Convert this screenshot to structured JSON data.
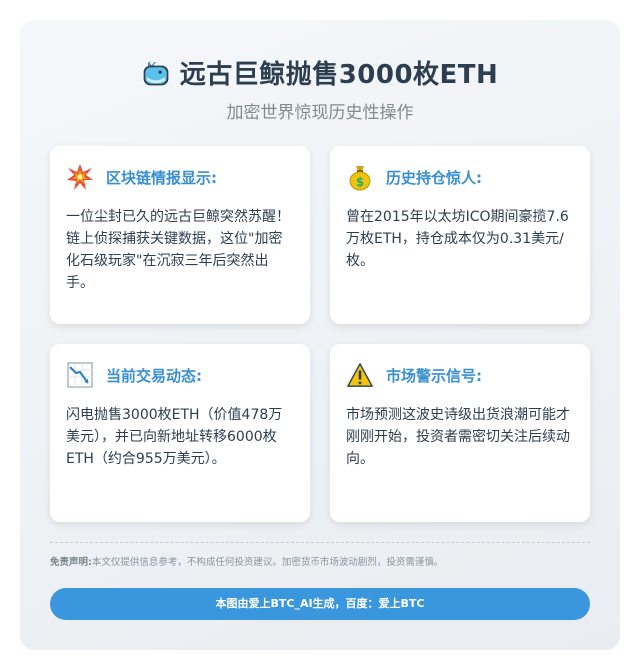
{
  "header": {
    "title": "远古巨鲸抛售3000枚ETH",
    "subtitle": "加密世界惊现历史性操作",
    "title_icon": "whale-icon"
  },
  "cards": [
    {
      "icon": "collision-icon",
      "title": "区块链情报显示:",
      "body": "一位尘封已久的远古巨鲸突然苏醒！链上侦探捕获关键数据，这位\"加密化石级玩家\"在沉寂三年后突然出手。"
    },
    {
      "icon": "money-bag-icon",
      "title": "历史持仓惊人:",
      "body": "曾在2015年以太坊ICO期间豪揽7.6万枚ETH，持仓成本仅为0.31美元/枚。"
    },
    {
      "icon": "chart-decreasing-icon",
      "title": "当前交易动态:",
      "body": "闪电抛售3000枚ETH（价值478万美元），并已向新地址转移6000枚ETH（约合955万美元）。"
    },
    {
      "icon": "warning-icon",
      "title": "市场警示信号:",
      "body": "市场预测这波史诗级出货浪潮可能才刚刚开始，投资者需密切关注后续动向。"
    }
  ],
  "footer": {
    "disclaimer_label": "免责声明:",
    "disclaimer_text": "本文仅提供信息参考，不构成任何投资建议。加密货币市场波动剧烈，投资需谨慎。",
    "banner": "本图由爱上BTC_AI生成，百度：爱上BTC"
  },
  "colors": {
    "accent": "#3a8fd1",
    "banner": "#3a96dd",
    "title": "#2c3e50"
  }
}
